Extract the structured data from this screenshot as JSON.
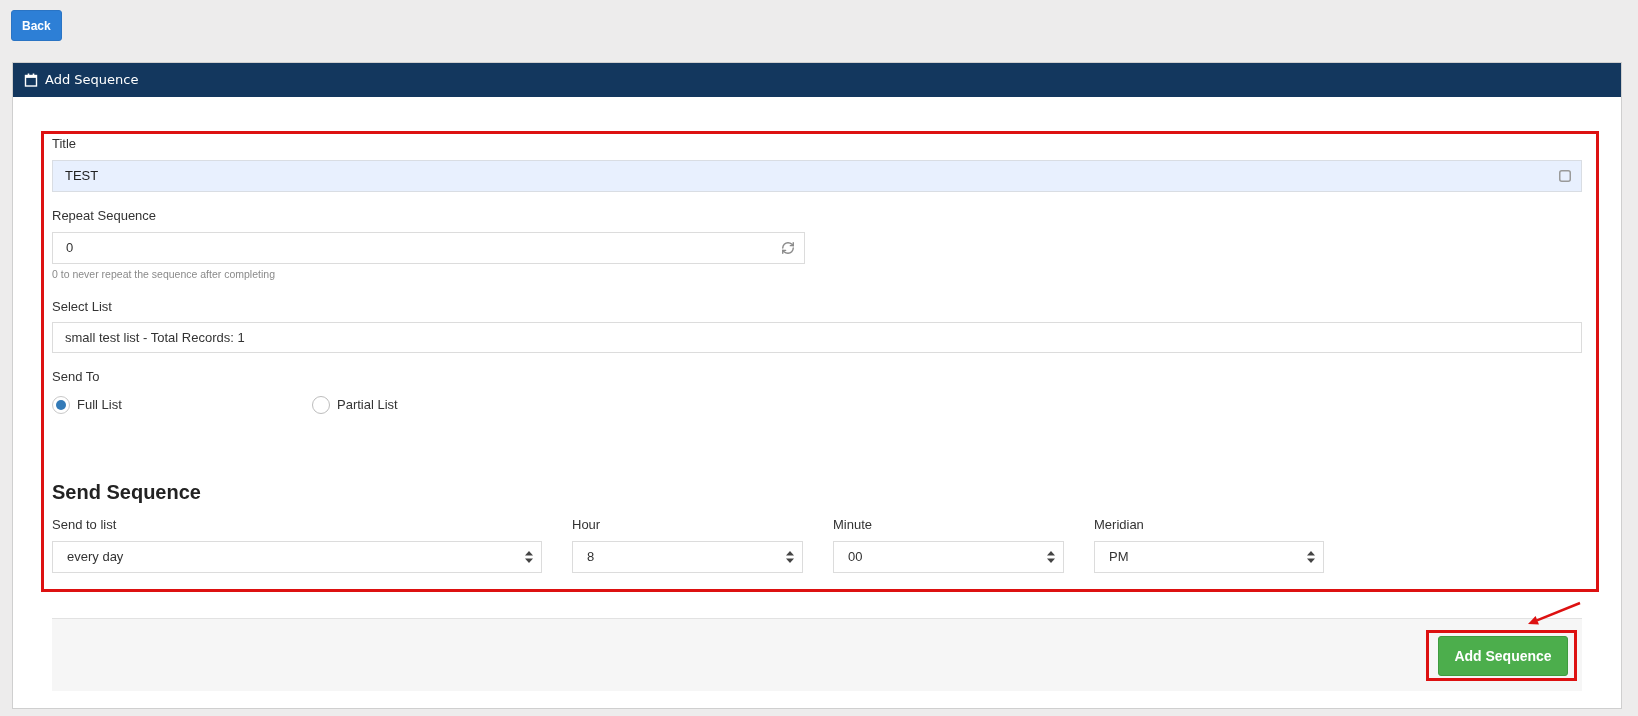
{
  "back_button": {
    "label": "Back"
  },
  "panel": {
    "title": "Add Sequence"
  },
  "form": {
    "title_field": {
      "label": "Title",
      "value": "TEST",
      "autofilled": true
    },
    "repeat_field": {
      "label": "Repeat Sequence",
      "value": "0",
      "hint": "0 to never repeat the sequence after completing"
    },
    "list_field": {
      "label": "Select List",
      "value": "small test list - Total Records: 1"
    },
    "send_to": {
      "label": "Send To",
      "options": [
        {
          "label": "Full List",
          "selected": true
        },
        {
          "label": "Partial List",
          "selected": false
        }
      ]
    }
  },
  "send_sequence": {
    "heading": "Send Sequence",
    "selects": [
      {
        "label": "Send to list",
        "value": "every day"
      },
      {
        "label": "Hour",
        "value": "8"
      },
      {
        "label": "Minute",
        "value": "00"
      },
      {
        "label": "Meridian",
        "value": "PM"
      }
    ]
  },
  "footer": {
    "submit_button": {
      "label": "Add Sequence"
    }
  }
}
